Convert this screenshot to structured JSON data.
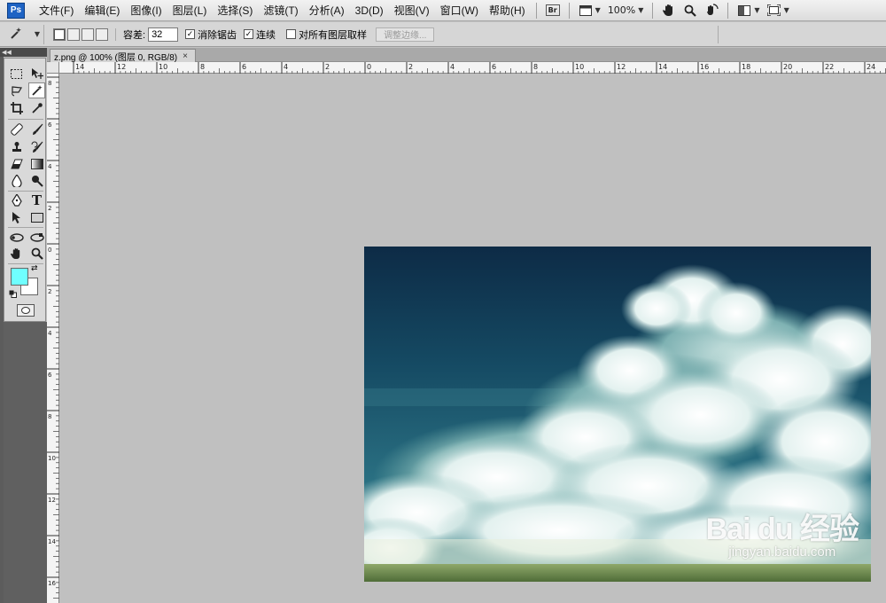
{
  "app": {
    "logo_text": "Ps"
  },
  "menus": [
    {
      "label": "文件(F)"
    },
    {
      "label": "编辑(E)"
    },
    {
      "label": "图像(I)"
    },
    {
      "label": "图层(L)"
    },
    {
      "label": "选择(S)"
    },
    {
      "label": "滤镜(T)"
    },
    {
      "label": "分析(A)"
    },
    {
      "label": "3D(D)"
    },
    {
      "label": "视图(V)"
    },
    {
      "label": "窗口(W)"
    },
    {
      "label": "帮助(H)"
    }
  ],
  "appbar": {
    "bridge_label": "Br",
    "zoom_value": "100%",
    "icons": [
      "bridge-icon",
      "view-extras-icon",
      "hand-icon",
      "zoom-icon",
      "rotate-view-icon",
      "arrange-documents-icon",
      "screen-mode-icon"
    ]
  },
  "options": {
    "tolerance_label": "容差:",
    "tolerance_value": "32",
    "anti_alias_label": "消除锯齿",
    "anti_alias_checked": true,
    "contiguous_label": "连续",
    "contiguous_checked": true,
    "sample_all_label": "对所有图层取样",
    "sample_all_checked": false,
    "refine_edge_label": "调整边缘..."
  },
  "document": {
    "tab_title": "z.png @ 100% (图层 0, RGB/8)",
    "close_symbol": "×"
  },
  "rulers": {
    "h_labels": [
      "14",
      "12",
      "10",
      "8",
      "6",
      "4",
      "2",
      "0",
      "2",
      "4",
      "6",
      "8",
      "10",
      "12",
      "14",
      "16",
      "18",
      "20",
      "22",
      "24"
    ],
    "v_labels": [
      "8",
      "6",
      "4",
      "2",
      "0",
      "2",
      "4",
      "6",
      "8",
      "10",
      "12",
      "14",
      "16"
    ]
  },
  "colors": {
    "foreground": "#6fffff",
    "background": "#ffffff"
  },
  "watermark": {
    "logo": "Bai du 经验",
    "url": "jingyan.baidu.com"
  }
}
